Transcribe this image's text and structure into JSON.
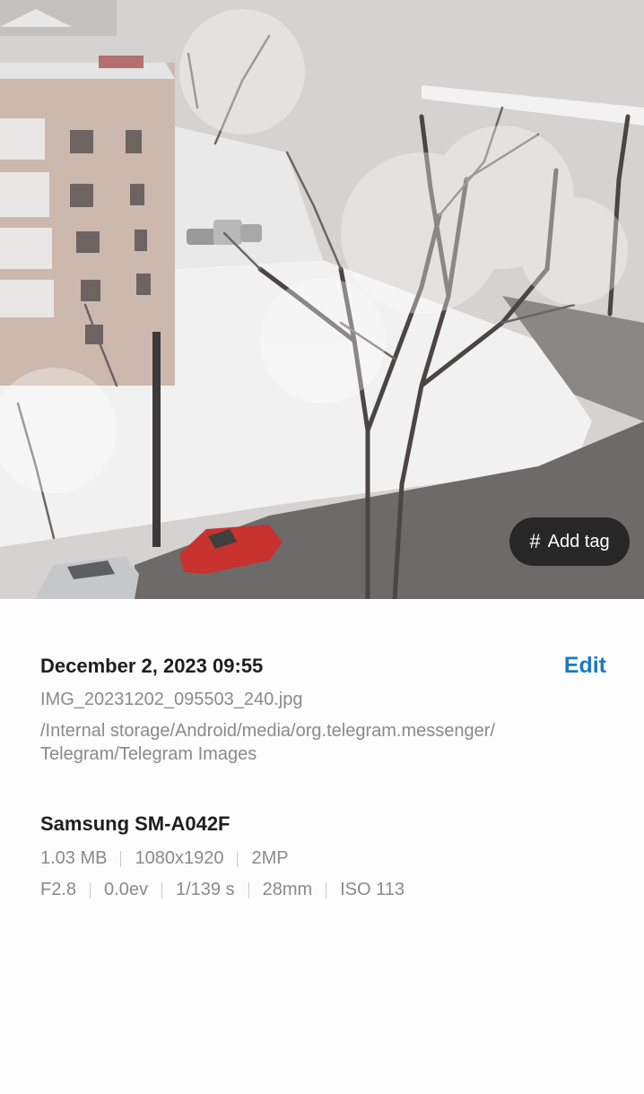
{
  "photo": {
    "add_tag_icon": "hash-icon",
    "add_tag_symbol": "#",
    "add_tag_label": "Add tag"
  },
  "details": {
    "datetime": "December 2, 2023 09:55",
    "edit_label": "Edit",
    "filename": "IMG_20231202_095503_240.jpg",
    "path_line1": "/Internal storage/Android/media/org.telegram.messenger/",
    "path_line2": "Telegram/Telegram Images",
    "device": "Samsung SM-A042F",
    "file_info": {
      "size": "1.03 MB",
      "resolution": "1080x1920",
      "megapixels": "2MP"
    },
    "camera_info": {
      "aperture": "F2.8",
      "exposure_value": "0.0ev",
      "shutter": "1/139 s",
      "focal_length": "28mm",
      "iso": "ISO 113"
    }
  },
  "colors": {
    "accent": "#1a79c7",
    "primary_text": "#1e1e1e",
    "secondary_text": "#8a8a8a"
  }
}
